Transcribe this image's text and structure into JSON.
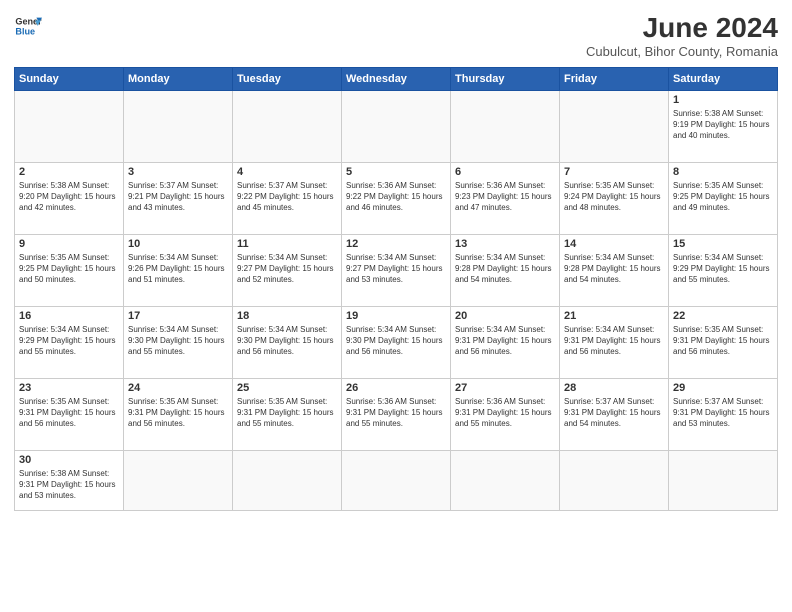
{
  "logo": {
    "text_general": "General",
    "text_blue": "Blue"
  },
  "title": "June 2024",
  "subtitle": "Cubulcut, Bihor County, Romania",
  "days_of_week": [
    "Sunday",
    "Monday",
    "Tuesday",
    "Wednesday",
    "Thursday",
    "Friday",
    "Saturday"
  ],
  "weeks": [
    [
      {
        "day": "",
        "info": ""
      },
      {
        "day": "",
        "info": ""
      },
      {
        "day": "",
        "info": ""
      },
      {
        "day": "",
        "info": ""
      },
      {
        "day": "",
        "info": ""
      },
      {
        "day": "",
        "info": ""
      },
      {
        "day": "1",
        "info": "Sunrise: 5:38 AM\nSunset: 9:19 PM\nDaylight: 15 hours\nand 40 minutes."
      }
    ],
    [
      {
        "day": "2",
        "info": "Sunrise: 5:38 AM\nSunset: 9:20 PM\nDaylight: 15 hours\nand 42 minutes."
      },
      {
        "day": "3",
        "info": "Sunrise: 5:37 AM\nSunset: 9:21 PM\nDaylight: 15 hours\nand 43 minutes."
      },
      {
        "day": "4",
        "info": "Sunrise: 5:37 AM\nSunset: 9:22 PM\nDaylight: 15 hours\nand 45 minutes."
      },
      {
        "day": "5",
        "info": "Sunrise: 5:36 AM\nSunset: 9:22 PM\nDaylight: 15 hours\nand 46 minutes."
      },
      {
        "day": "6",
        "info": "Sunrise: 5:36 AM\nSunset: 9:23 PM\nDaylight: 15 hours\nand 47 minutes."
      },
      {
        "day": "7",
        "info": "Sunrise: 5:35 AM\nSunset: 9:24 PM\nDaylight: 15 hours\nand 48 minutes."
      },
      {
        "day": "8",
        "info": "Sunrise: 5:35 AM\nSunset: 9:25 PM\nDaylight: 15 hours\nand 49 minutes."
      }
    ],
    [
      {
        "day": "9",
        "info": "Sunrise: 5:35 AM\nSunset: 9:25 PM\nDaylight: 15 hours\nand 50 minutes."
      },
      {
        "day": "10",
        "info": "Sunrise: 5:34 AM\nSunset: 9:26 PM\nDaylight: 15 hours\nand 51 minutes."
      },
      {
        "day": "11",
        "info": "Sunrise: 5:34 AM\nSunset: 9:27 PM\nDaylight: 15 hours\nand 52 minutes."
      },
      {
        "day": "12",
        "info": "Sunrise: 5:34 AM\nSunset: 9:27 PM\nDaylight: 15 hours\nand 53 minutes."
      },
      {
        "day": "13",
        "info": "Sunrise: 5:34 AM\nSunset: 9:28 PM\nDaylight: 15 hours\nand 54 minutes."
      },
      {
        "day": "14",
        "info": "Sunrise: 5:34 AM\nSunset: 9:28 PM\nDaylight: 15 hours\nand 54 minutes."
      },
      {
        "day": "15",
        "info": "Sunrise: 5:34 AM\nSunset: 9:29 PM\nDaylight: 15 hours\nand 55 minutes."
      }
    ],
    [
      {
        "day": "16",
        "info": "Sunrise: 5:34 AM\nSunset: 9:29 PM\nDaylight: 15 hours\nand 55 minutes."
      },
      {
        "day": "17",
        "info": "Sunrise: 5:34 AM\nSunset: 9:30 PM\nDaylight: 15 hours\nand 55 minutes."
      },
      {
        "day": "18",
        "info": "Sunrise: 5:34 AM\nSunset: 9:30 PM\nDaylight: 15 hours\nand 56 minutes."
      },
      {
        "day": "19",
        "info": "Sunrise: 5:34 AM\nSunset: 9:30 PM\nDaylight: 15 hours\nand 56 minutes."
      },
      {
        "day": "20",
        "info": "Sunrise: 5:34 AM\nSunset: 9:31 PM\nDaylight: 15 hours\nand 56 minutes."
      },
      {
        "day": "21",
        "info": "Sunrise: 5:34 AM\nSunset: 9:31 PM\nDaylight: 15 hours\nand 56 minutes."
      },
      {
        "day": "22",
        "info": "Sunrise: 5:35 AM\nSunset: 9:31 PM\nDaylight: 15 hours\nand 56 minutes."
      }
    ],
    [
      {
        "day": "23",
        "info": "Sunrise: 5:35 AM\nSunset: 9:31 PM\nDaylight: 15 hours\nand 56 minutes."
      },
      {
        "day": "24",
        "info": "Sunrise: 5:35 AM\nSunset: 9:31 PM\nDaylight: 15 hours\nand 56 minutes."
      },
      {
        "day": "25",
        "info": "Sunrise: 5:35 AM\nSunset: 9:31 PM\nDaylight: 15 hours\nand 55 minutes."
      },
      {
        "day": "26",
        "info": "Sunrise: 5:36 AM\nSunset: 9:31 PM\nDaylight: 15 hours\nand 55 minutes."
      },
      {
        "day": "27",
        "info": "Sunrise: 5:36 AM\nSunset: 9:31 PM\nDaylight: 15 hours\nand 55 minutes."
      },
      {
        "day": "28",
        "info": "Sunrise: 5:37 AM\nSunset: 9:31 PM\nDaylight: 15 hours\nand 54 minutes."
      },
      {
        "day": "29",
        "info": "Sunrise: 5:37 AM\nSunset: 9:31 PM\nDaylight: 15 hours\nand 53 minutes."
      }
    ],
    [
      {
        "day": "30",
        "info": "Sunrise: 5:38 AM\nSunset: 9:31 PM\nDaylight: 15 hours\nand 53 minutes."
      },
      {
        "day": "",
        "info": ""
      },
      {
        "day": "",
        "info": ""
      },
      {
        "day": "",
        "info": ""
      },
      {
        "day": "",
        "info": ""
      },
      {
        "day": "",
        "info": ""
      },
      {
        "day": "",
        "info": ""
      }
    ]
  ]
}
